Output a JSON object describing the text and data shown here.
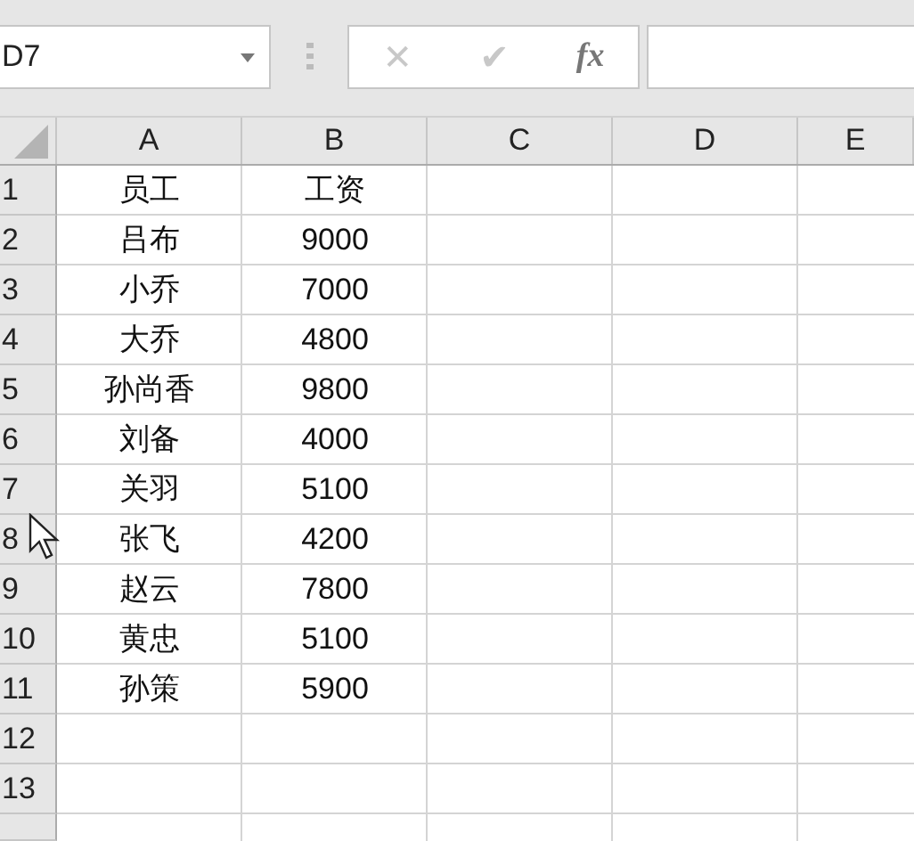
{
  "name_box": {
    "value": "D7"
  },
  "formula_bar": {
    "cancel": "✕",
    "enter": "✔",
    "function": "fx"
  },
  "columns": [
    "A",
    "B",
    "C",
    "D",
    "E"
  ],
  "rows": [
    {
      "header": "1",
      "cells": [
        "员工",
        "工资"
      ]
    },
    {
      "header": "2",
      "cells": [
        "吕布",
        "9000"
      ]
    },
    {
      "header": "3",
      "cells": [
        "小乔",
        "7000"
      ]
    },
    {
      "header": "4",
      "cells": [
        "大乔",
        "4800"
      ]
    },
    {
      "header": "5",
      "cells": [
        "孙尚香",
        "9800"
      ]
    },
    {
      "header": "6",
      "cells": [
        "刘备",
        "4000"
      ]
    },
    {
      "header": "7",
      "cells": [
        "关羽",
        "5100"
      ]
    },
    {
      "header": "8",
      "cells": [
        "张飞",
        "4200"
      ]
    },
    {
      "header": "9",
      "cells": [
        "赵云",
        "7800"
      ]
    },
    {
      "header": "10",
      "cells": [
        "黄忠",
        "5100"
      ]
    },
    {
      "header": "11",
      "cells": [
        "孙策",
        "5900"
      ]
    },
    {
      "header": "12",
      "cells": []
    },
    {
      "header": "13",
      "cells": []
    }
  ]
}
